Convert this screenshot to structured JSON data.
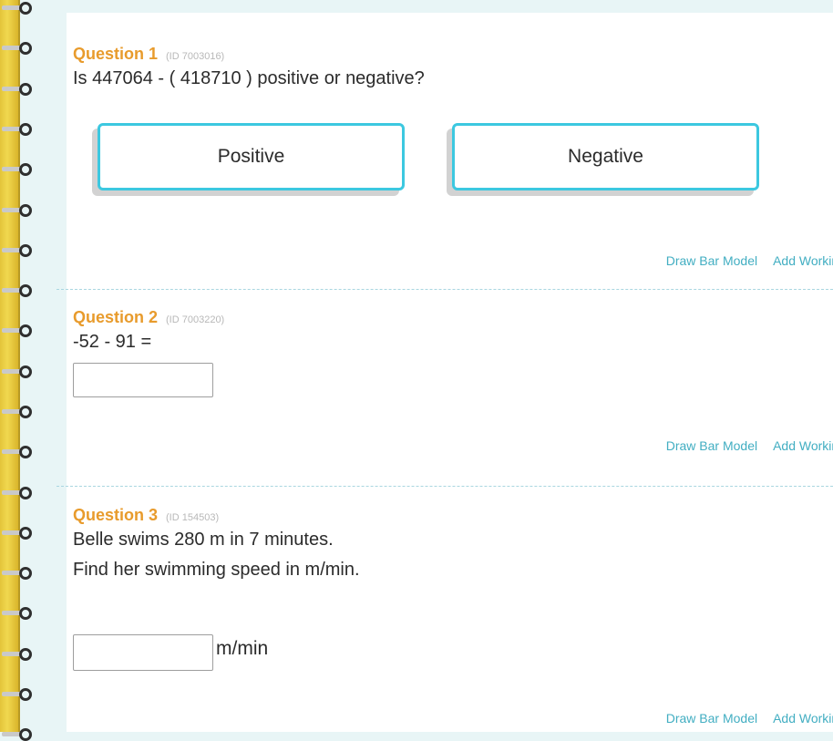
{
  "questions": [
    {
      "title": "Question 1",
      "id": "(ID 7003016)",
      "lines": [
        "Is 447064 - ( 418710 ) positive or negative?"
      ],
      "choices": [
        "Positive",
        "Negative"
      ]
    },
    {
      "title": "Question 2",
      "id": "(ID 7003220)",
      "lines": [
        "-52 - 91 ="
      ]
    },
    {
      "title": "Question 3",
      "id": "(ID 154503)",
      "lines": [
        "Belle swims 280 m in 7 minutes.",
        "Find her swimming speed in m/min."
      ],
      "unit": "m/min"
    }
  ],
  "tools": {
    "draw_bar_model": "Draw Bar Model",
    "add_working": "Add Working"
  },
  "colors": {
    "question_title": "#e89b2c",
    "choice_border": "#3cc8e0",
    "tool_link": "#42aec2",
    "spine": "#f1d84f"
  }
}
